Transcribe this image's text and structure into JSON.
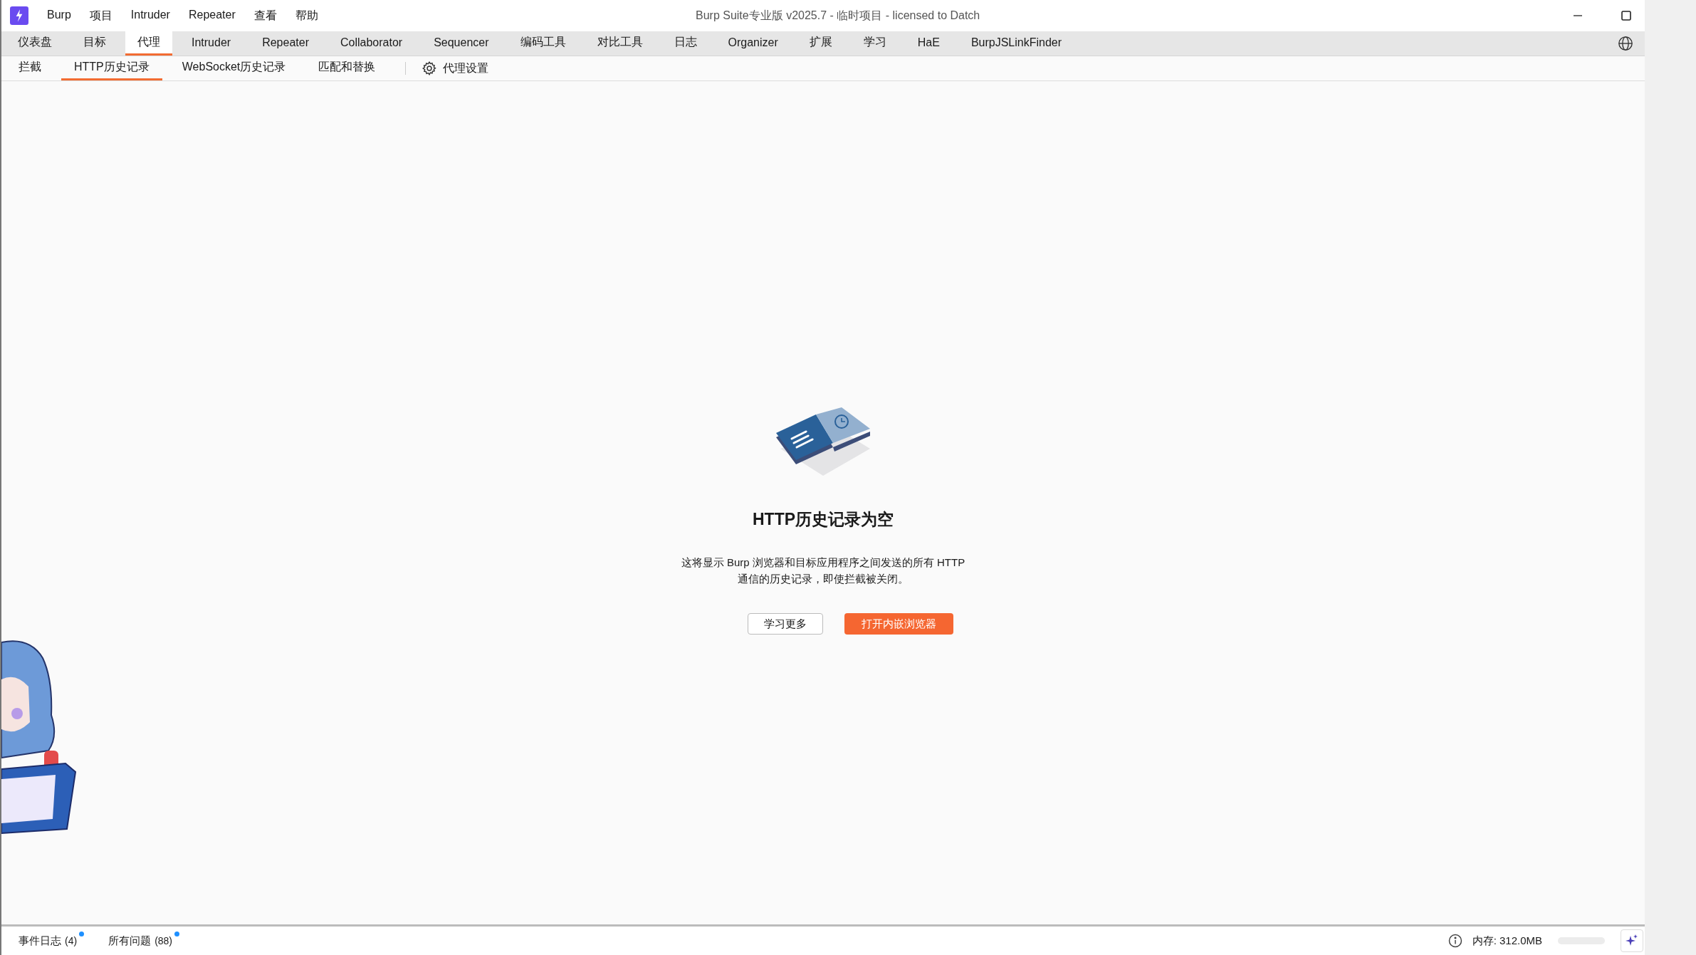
{
  "window": {
    "title": "Burp Suite专业版  v2025.7 - 临时项目 - licensed to Datch"
  },
  "menu": [
    "Burp",
    "项目",
    "Intruder",
    "Repeater",
    "查看",
    "帮助"
  ],
  "tabs": [
    {
      "label": "仪表盘",
      "selected": false
    },
    {
      "label": "目标",
      "selected": false
    },
    {
      "label": "代理",
      "selected": true
    },
    {
      "label": "Intruder",
      "selected": false
    },
    {
      "label": "Repeater",
      "selected": false
    },
    {
      "label": "Collaborator",
      "selected": false
    },
    {
      "label": "Sequencer",
      "selected": false
    },
    {
      "label": "编码工具",
      "selected": false
    },
    {
      "label": "对比工具",
      "selected": false
    },
    {
      "label": "日志",
      "selected": false
    },
    {
      "label": "Organizer",
      "selected": false
    },
    {
      "label": "扩展",
      "selected": false
    },
    {
      "label": "学习",
      "selected": false
    },
    {
      "label": "HaE",
      "selected": false
    },
    {
      "label": "BurpJSLinkFinder",
      "selected": false
    }
  ],
  "subtabs": [
    {
      "label": "拦截",
      "selected": false
    },
    {
      "label": "HTTP历史记录",
      "selected": true
    },
    {
      "label": "WebSocket历史记录",
      "selected": false
    },
    {
      "label": "匹配和替换",
      "selected": false
    }
  ],
  "proxy_settings": "代理设置",
  "empty_state": {
    "title": "HTTP历史记录为空",
    "description_lines": [
      "这将显示 Burp 浏览器和目标应用程序之间发送的所有 HTTP",
      "通信的历史记录，即使拦截被关闭。"
    ],
    "buttons": [
      {
        "label": "学习更多",
        "kind": "secondary"
      },
      {
        "label": "打开内嵌浏览器",
        "kind": "primary"
      }
    ]
  },
  "status_bar": {
    "items": [
      {
        "label": "事件日志",
        "count": "(4)",
        "unread": true
      },
      {
        "label": "所有问题",
        "count": "(88)",
        "unread": true
      }
    ],
    "memory": "内存: 312.0MB"
  }
}
